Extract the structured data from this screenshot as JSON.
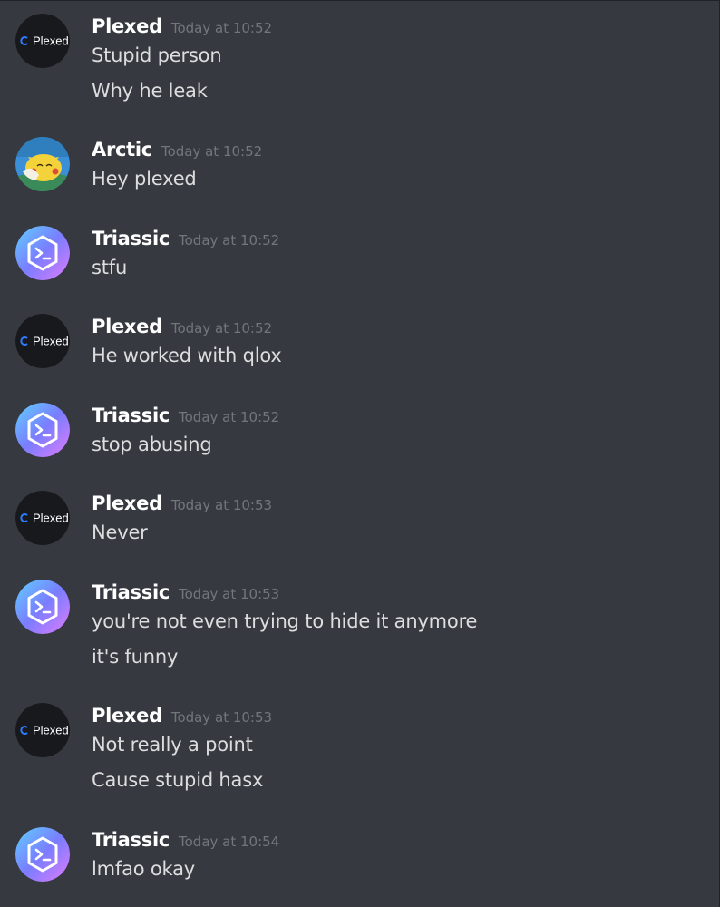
{
  "messages": [
    {
      "author": "Plexed",
      "avatar": "plexed-logo-avatar",
      "avatar_text": "Plexed",
      "timestamp": "Today at 10:52",
      "lines": [
        "Stupid person",
        "Why he leak"
      ]
    },
    {
      "author": "Arctic",
      "avatar": "pikachu-avatar",
      "timestamp": "Today at 10:52",
      "lines": [
        "Hey plexed"
      ]
    },
    {
      "author": "Triassic",
      "avatar": "terminal-hexagon-avatar",
      "timestamp": "Today at 10:52",
      "lines": [
        "stfu"
      ]
    },
    {
      "author": "Plexed",
      "avatar": "plexed-logo-avatar",
      "avatar_text": "Plexed",
      "timestamp": "Today at 10:52",
      "lines": [
        "He worked with qlox"
      ]
    },
    {
      "author": "Triassic",
      "avatar": "terminal-hexagon-avatar",
      "timestamp": "Today at 10:52",
      "lines": [
        "stop abusing"
      ]
    },
    {
      "author": "Plexed",
      "avatar": "plexed-logo-avatar",
      "avatar_text": "Plexed",
      "timestamp": "Today at 10:53",
      "lines": [
        "Never"
      ]
    },
    {
      "author": "Triassic",
      "avatar": "terminal-hexagon-avatar",
      "timestamp": "Today at 10:53",
      "lines": [
        "you're not even trying to hide it anymore",
        "it's funny"
      ]
    },
    {
      "author": "Plexed",
      "avatar": "plexed-logo-avatar",
      "avatar_text": "Plexed",
      "timestamp": "Today at 10:53",
      "lines": [
        "Not really a point",
        "Cause stupid hasx"
      ]
    },
    {
      "author": "Triassic",
      "avatar": "terminal-hexagon-avatar",
      "timestamp": "Today at 10:54",
      "lines": [
        "lmfao okay"
      ]
    }
  ],
  "colors": {
    "background": "#36393f",
    "author": "#ffffff",
    "timestamp": "#72767d",
    "message_text": "#dcddde"
  }
}
